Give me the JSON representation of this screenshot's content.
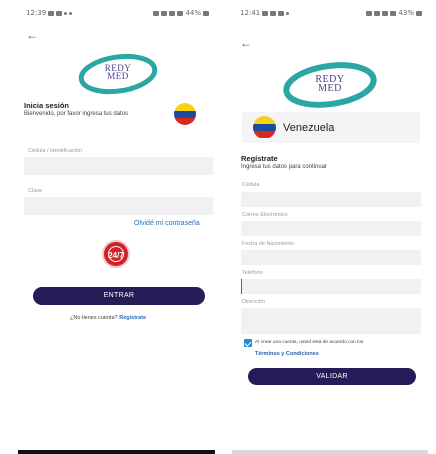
{
  "login_screen": {
    "status_time": "12:39",
    "status_battery": "44%",
    "logo_line1": "REDY",
    "logo_line2": "MED",
    "heading": "Inicia sesión",
    "subheading": "Bienvenido, por favor ingresa tus datos",
    "fields": [
      {
        "label": "Cédula / Identificación",
        "value": ""
      },
      {
        "label": "Clave",
        "value": ""
      }
    ],
    "forgot_password": "Olvidé mi contraseña",
    "badge_text": "24/7",
    "submit_label": "ENTRAR",
    "no_account_text": "¿No tienes cuenta?",
    "register_link": "Regístrate"
  },
  "register_screen": {
    "status_time": "12:41",
    "status_battery": "43%",
    "logo_line1": "REDY",
    "logo_line2": "MED",
    "country": "Venezuela",
    "heading": "Regístrate",
    "subheading": "Ingresa tus datos para continuar",
    "fields": [
      {
        "label": "Cédula",
        "value": ""
      },
      {
        "label": "Correo Electrónico",
        "value": ""
      },
      {
        "label": "Fecha de Nacimiento",
        "value": ""
      },
      {
        "label": "Teléfono",
        "value": ""
      },
      {
        "label": "Dirección",
        "value": ""
      }
    ],
    "terms_text": "Al crear una cuenta, usted está de acuerdo con los",
    "terms_link": "Términos y Condiciones",
    "submit_label": "VALIDAR"
  },
  "colors": {
    "button": "#241d57",
    "link": "#2a6fbd",
    "badge": "#d12229",
    "checkbox": "#1e8fd6"
  }
}
